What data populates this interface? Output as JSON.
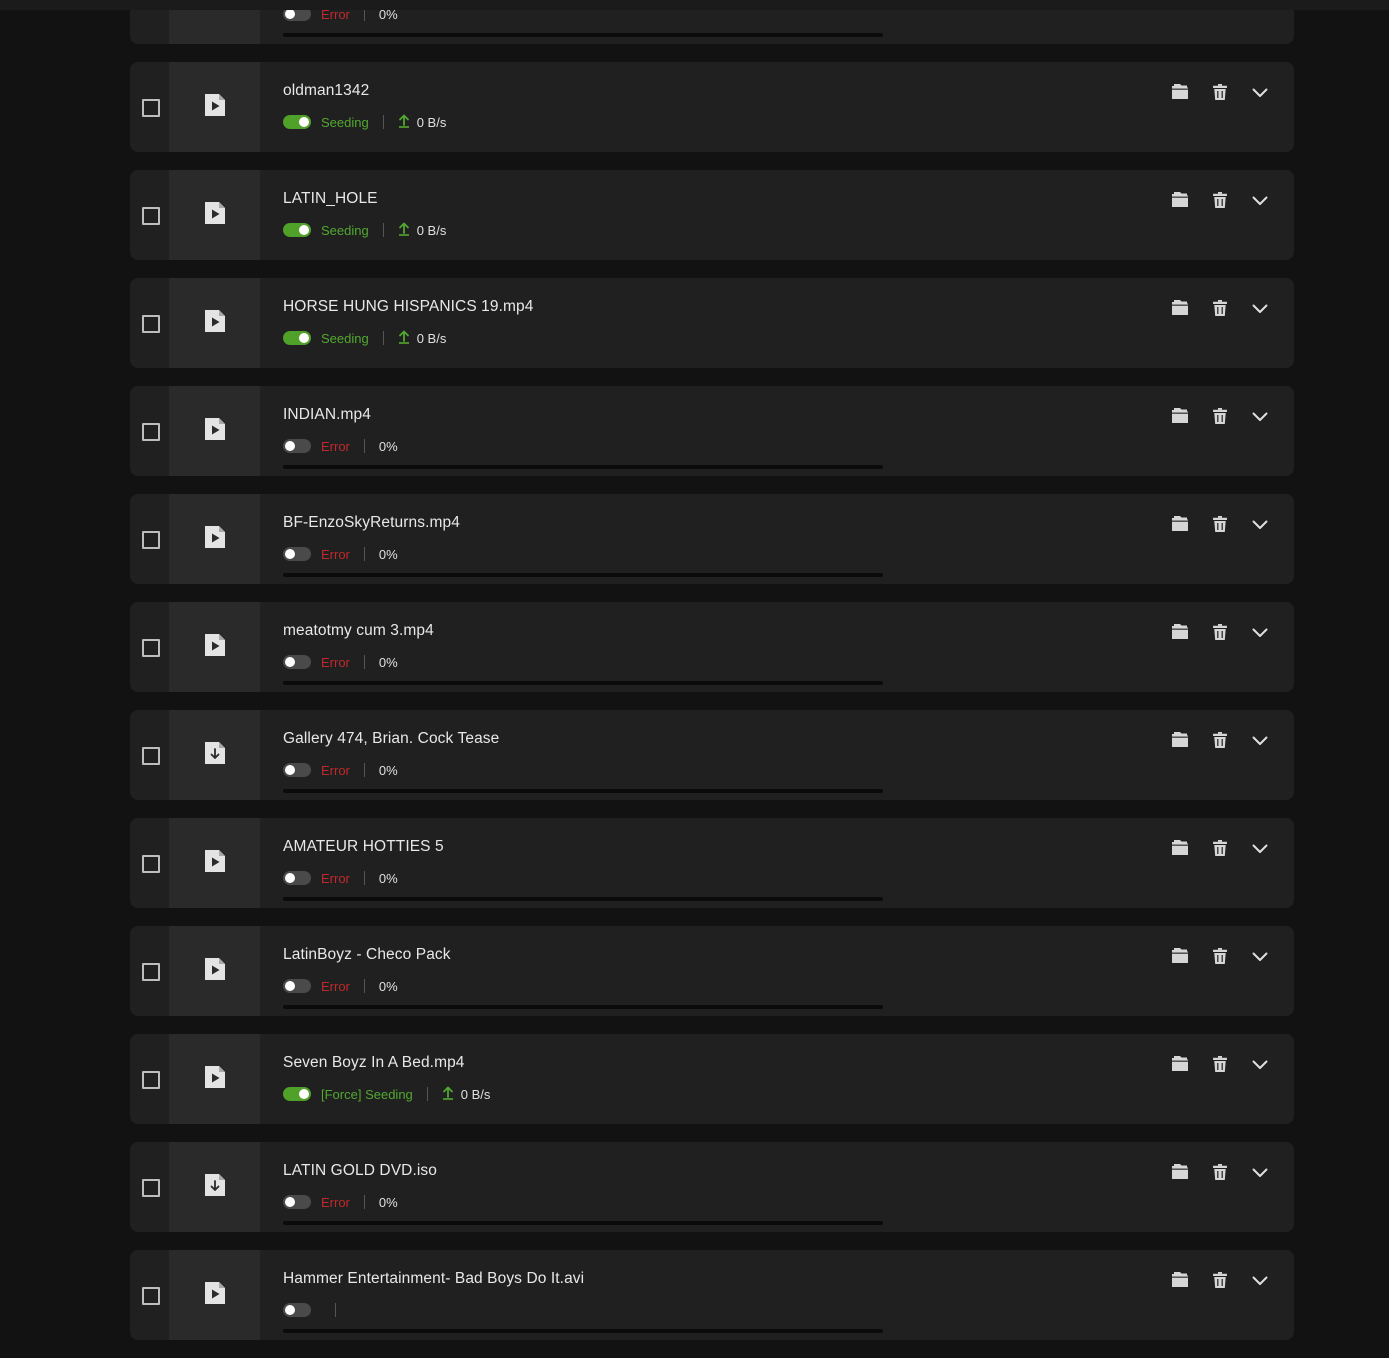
{
  "items": [
    {
      "name": "",
      "status": "Error",
      "state": "error",
      "percent": "0%",
      "progress": 0,
      "icon": "video-file-icon"
    },
    {
      "name": "oldman1342",
      "status": "Seeding",
      "state": "seeding",
      "speed": "0 B/s",
      "icon": "video-file-icon"
    },
    {
      "name": "LATIN_HOLE",
      "status": "Seeding",
      "state": "seeding",
      "speed": "0 B/s",
      "icon": "video-file-icon"
    },
    {
      "name": "HORSE HUNG HISPANICS 19.mp4",
      "status": "Seeding",
      "state": "seeding",
      "speed": "0 B/s",
      "icon": "video-file-icon"
    },
    {
      "name": "INDIAN.mp4",
      "status": "Error",
      "state": "error",
      "percent": "0%",
      "progress": 0,
      "icon": "video-file-icon"
    },
    {
      "name": "BF-EnzoSkyReturns.mp4",
      "status": "Error",
      "state": "error",
      "percent": "0%",
      "progress": 0,
      "icon": "video-file-icon"
    },
    {
      "name": "meatotmy cum 3.mp4",
      "status": "Error",
      "state": "error",
      "percent": "0%",
      "progress": 0,
      "icon": "video-file-icon"
    },
    {
      "name": "Gallery 474, Brian. Cock Tease",
      "status": "Error",
      "state": "error",
      "percent": "0%",
      "progress": 0,
      "icon": "download-file-icon"
    },
    {
      "name": "AMATEUR HOTTIES 5",
      "status": "Error",
      "state": "error",
      "percent": "0%",
      "progress": 0,
      "icon": "video-file-icon"
    },
    {
      "name": "LatinBoyz - Checo Pack",
      "status": "Error",
      "state": "error",
      "percent": "0%",
      "progress": 0,
      "icon": "video-file-icon"
    },
    {
      "name": "Seven Boyz In A Bed.mp4",
      "status": "[Force] Seeding",
      "state": "seeding",
      "speed": "0 B/s",
      "icon": "video-file-icon"
    },
    {
      "name": "LATIN GOLD DVD.iso",
      "status": "Error",
      "state": "error",
      "percent": "0%",
      "progress": 0,
      "icon": "download-file-icon"
    },
    {
      "name": "Hammer Entertainment- Bad Boys Do It.avi",
      "status": "",
      "state": "error",
      "percent": "",
      "progress": 0,
      "icon": "video-file-icon"
    }
  ],
  "colors": {
    "seeding": "#52a830",
    "error": "#c0292c",
    "background": "#121212",
    "card": "#202020"
  }
}
